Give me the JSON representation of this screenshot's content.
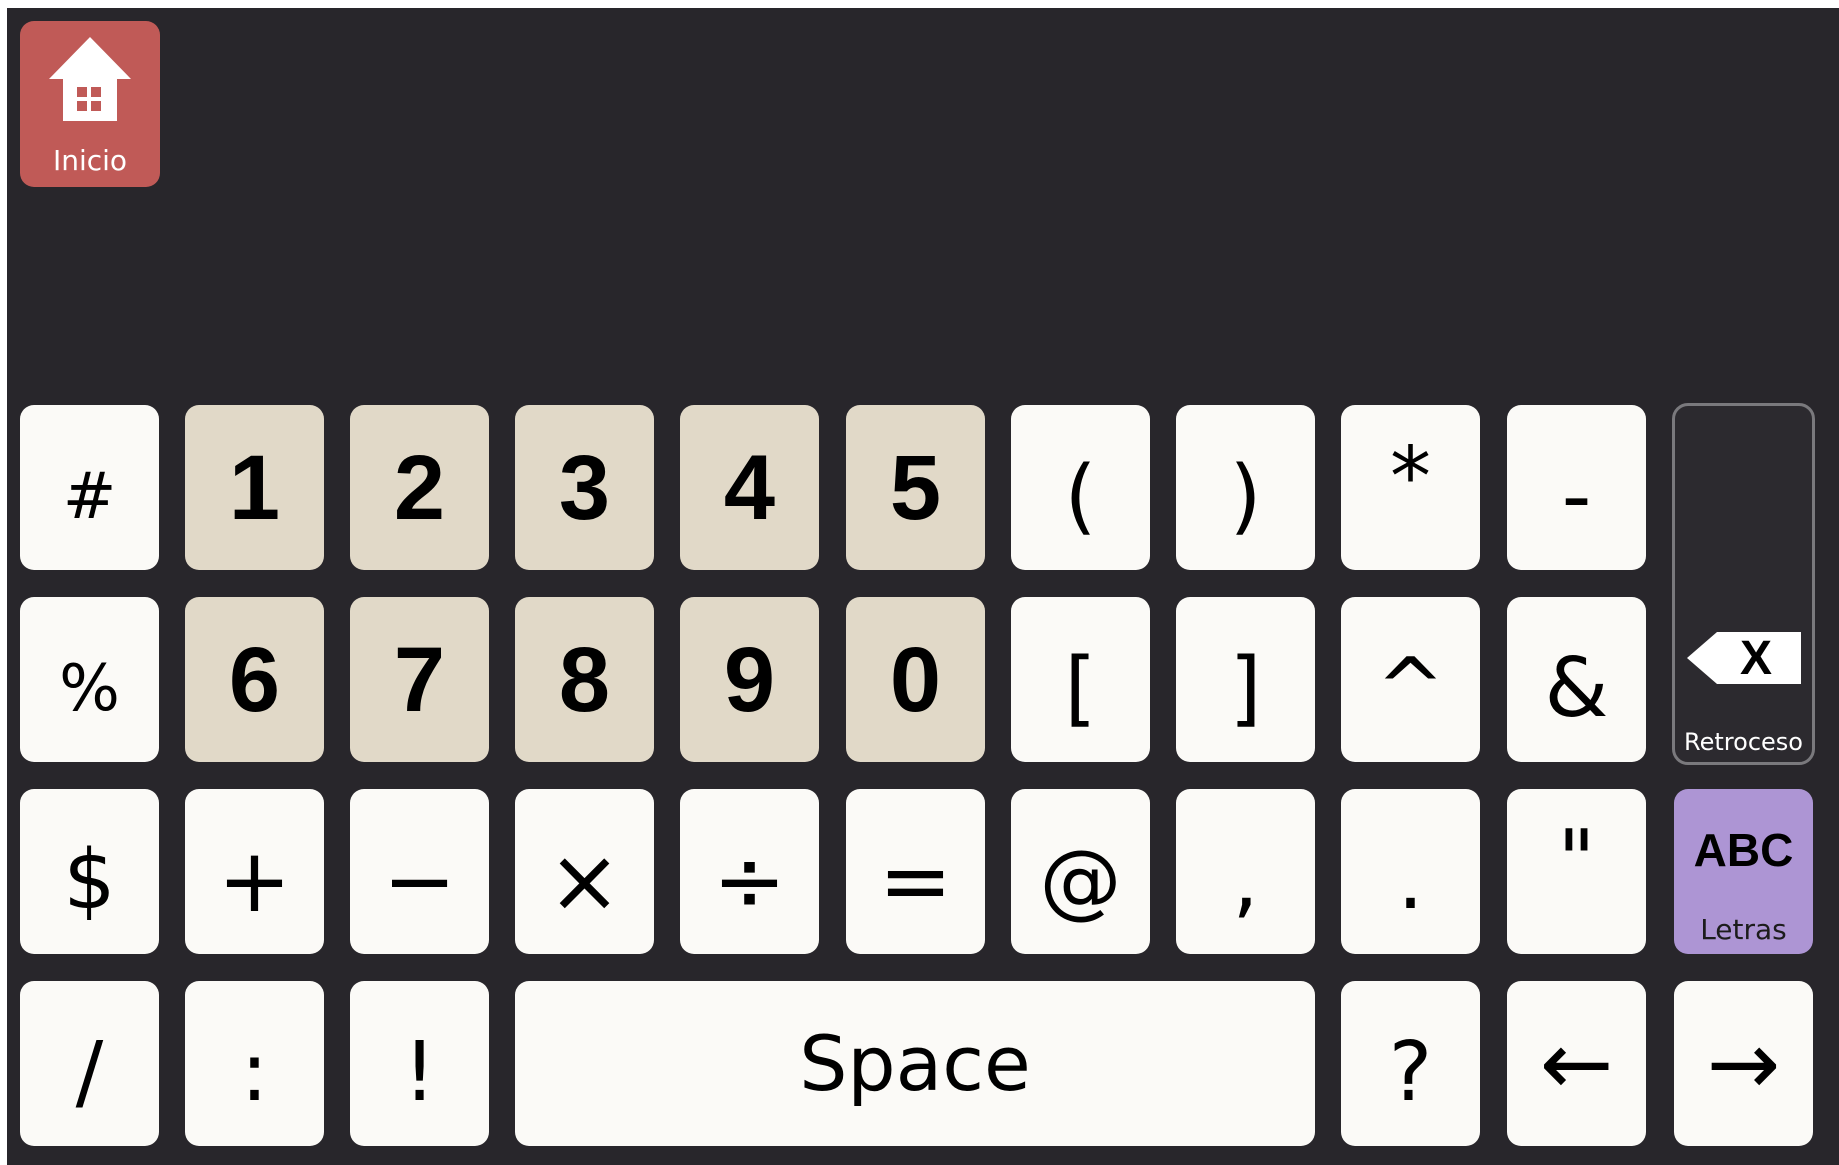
{
  "home": {
    "label": "Inicio",
    "color": "#c05a57"
  },
  "rows": [
    [
      "#",
      "1",
      "2",
      "3",
      "4",
      "5",
      "(",
      ")",
      "*",
      "-"
    ],
    [
      "%",
      "6",
      "7",
      "8",
      "9",
      "0",
      "[",
      "]",
      "^",
      "&"
    ],
    [
      "$",
      "+",
      "−",
      "×",
      "÷",
      "=",
      "@",
      ",",
      ".",
      "\""
    ],
    [
      "/",
      ":",
      "!",
      "Space",
      "?",
      "←",
      "→"
    ]
  ],
  "backspace": {
    "label": "Retroceso"
  },
  "abc": {
    "text": "ABC",
    "label": "Letras",
    "color": "#ad95d4"
  },
  "colors": {
    "background": "#28262b",
    "key": "#fbfaf7",
    "number_key": "#e1d9c8"
  }
}
